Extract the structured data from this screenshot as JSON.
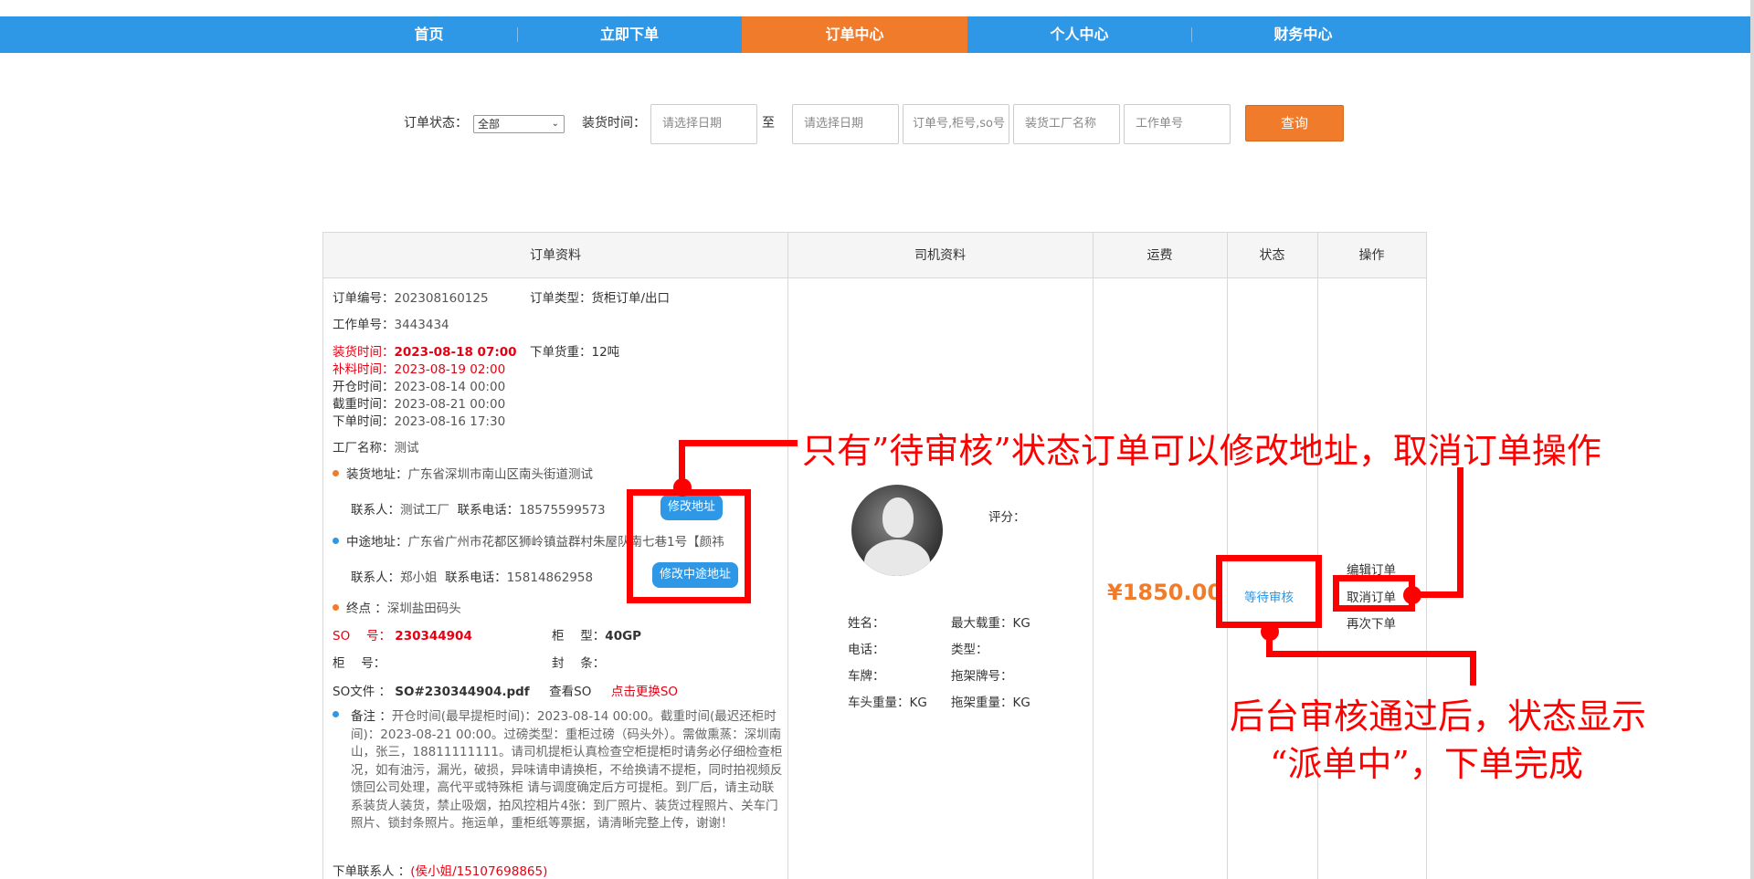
{
  "nav": {
    "items": [
      {
        "label": "首页"
      },
      {
        "label": "立即下单"
      },
      {
        "label": "订单中心"
      },
      {
        "label": "个人中心"
      },
      {
        "label": "财务中心"
      }
    ],
    "active_index": 2,
    "bar_color": "#2e97e6",
    "active_color": "#f07b2b"
  },
  "filter": {
    "status_label": "订单状态：",
    "status_value": "全部",
    "load_time_label": "装货时间：",
    "date_start_placeholder": "请选择日期",
    "to_label": "至",
    "date_end_placeholder": "请选择日期",
    "order_no_placeholder": "订单号,柜号,so号",
    "factory_placeholder": "装货工厂名称",
    "work_no_placeholder": "工作单号",
    "query_button": "查询"
  },
  "table": {
    "headers": [
      "订单资料",
      "司机资料",
      "运费",
      "状态",
      "操作"
    ]
  },
  "order": {
    "order_no_label": "订单编号：",
    "order_no": "202308160125",
    "order_type_label": "订单类型：",
    "order_type": "货柜订单/出口",
    "work_no_label": "工作单号：",
    "work_no": "3443434",
    "load_time_label": "装货时间：",
    "load_time": "2023-08-18 07:00",
    "weight_label": "下单货重：",
    "weight": "12吨",
    "supplement_time_label": "补料时间：",
    "supplement_time": "2023-08-19 02:00",
    "open_time_label": "开仓时间：",
    "open_time": "2023-08-14 00:00",
    "cutoff_time_label": "截重时间：",
    "cutoff_time": "2023-08-21 00:00",
    "create_time_label": "下单时间：",
    "create_time": "2023-08-16 17:30",
    "factory_label": "工厂名称：",
    "factory": "测试",
    "load_addr_label": "装货地址：",
    "load_addr": "广东省深圳市南山区南头街道测试",
    "contact_label": "联系人：",
    "contact": "测试工厂",
    "phone_label": "联系电话：",
    "phone": "18575599573",
    "modify_addr_button": "修改地址",
    "mid_addr_label": "中途地址：",
    "mid_addr": "广东省广州市花都区狮岭镇益群村朱屋队南七巷1号【颜祎",
    "mid_contact_label": "联系人：",
    "mid_contact": "郑小姐",
    "mid_phone_label": "联系电话：",
    "mid_phone": "15814862958",
    "modify_mid_addr_button": "修改中途地址",
    "end_label": "终点 ：",
    "end": "深圳盐田码头",
    "so_label": "SO　 号：",
    "so": "230344904",
    "container_type_label": "柜　 型：",
    "container_type": "40GP",
    "container_no_label": "柜　 号：",
    "container_no": "",
    "seal_label": "封　 条：",
    "seal": "",
    "so_file_label": "SO文件 ：",
    "so_file": "SO#230344904.pdf",
    "view_so": "查看SO",
    "replace_so": "点击更换SO",
    "remark_label": "备注 ：",
    "remark": "开仓时间(最早提柜时间)：2023-08-14 00:00。截重时间(最迟还柜时间)：2023-08-21 00:00。过磅类型：重柜过磅（码头外）。需做熏蒸：深圳南山，张三，18811111111。请司机提柜认真检查空柜提柜时请务必仔细检查柜况，如有油污，漏光，破损，异味请申请换柜，不给换请不提柜，同时拍视频反馈回公司处理，高代平或特殊柜 请与调度确定后方可提柜。到厂后，请主动联系装货人装货，禁止吸烟，拍风控相片4张：到厂照片、装货过程照片、关车门照片、锁封条照片。拖运单，重柜纸等票据，请清晰完整上传，谢谢！",
    "order_contact_label": "下单联系人 ：",
    "order_contact": "(侯小姐/15107698865)"
  },
  "driver": {
    "rating_label": "评分：",
    "name_label": "姓名：",
    "max_load_label": "最大载重：KG",
    "phone_label": "电话：",
    "type_label": "类型：",
    "plate_label": "车牌：",
    "trailer_label": "拖架牌号：",
    "head_weight_label": "车头重量：KG",
    "trailer_weight_label": "拖架重量：KG"
  },
  "fee": "¥1850.00",
  "status": "等待审核",
  "ops": {
    "edit": "编辑订单",
    "cancel": "取消订单",
    "reorder": "再次下单"
  },
  "annotations": {
    "top_note": "只有”待审核”状态订单可以修改地址，取消订单操作",
    "bottom_note_line1": "后台审核通过后，状态显示",
    "bottom_note_line2": "“派单中”，下单完成",
    "color": "#ff0000"
  }
}
